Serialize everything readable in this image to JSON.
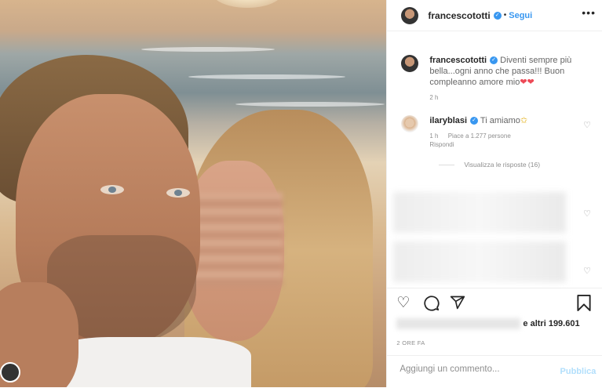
{
  "post": {
    "author": "francescototti",
    "follow_label": "Segui",
    "more_icon": "ellipsis-icon",
    "separator": "•"
  },
  "caption": {
    "author": "francescototti",
    "text": "Diventi sempre più bella...ogni anno che passa!!! Buon compleanno amore mio",
    "emoji": "❤❤",
    "time": "2 h"
  },
  "reply": {
    "author": "ilaryblasi",
    "text": "Ti amiamo",
    "emoji": "✩",
    "time": "1 h",
    "likes": "Piace a 1.277 persone",
    "reply_label": "Rispondi",
    "view_replies": "Visualizza le risposte (16)"
  },
  "actions": {
    "like_icon": "heart-icon",
    "comment_icon": "comment-icon",
    "share_icon": "share-icon",
    "save_icon": "bookmark-icon"
  },
  "likes_text": "e altri 199.601",
  "timestamp": "2 ORE FA",
  "add_comment": {
    "placeholder": "Aggiungi un commento...",
    "publish_label": "Pubblica"
  },
  "colors": {
    "accent": "#3897f0",
    "publish_disabled": "#b2dffc",
    "like_red": "#ed4956"
  }
}
